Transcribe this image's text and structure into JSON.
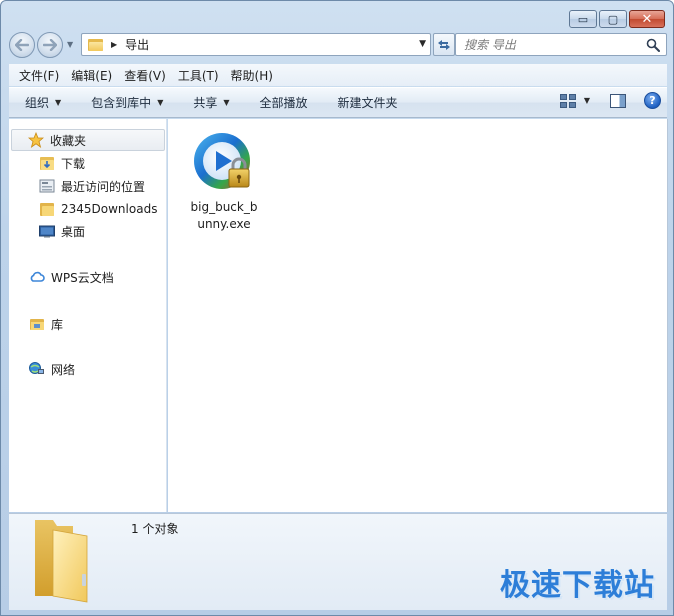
{
  "window": {
    "caption_buttons": {
      "minimize": "▭",
      "maximize": "▢",
      "close": "✕"
    }
  },
  "navigation": {
    "back_icon": "back-arrow-icon",
    "forward_icon": "forward-arrow-icon",
    "breadcrumb": {
      "current": "导出"
    },
    "search": {
      "placeholder": "搜索 导出"
    }
  },
  "menubar": {
    "items": [
      "文件(F)",
      "编辑(E)",
      "查看(V)",
      "工具(T)",
      "帮助(H)"
    ]
  },
  "command_bar": {
    "organize": "组织",
    "include_in_library": "包含到库中",
    "share": "共享",
    "play_all": "全部播放",
    "new_folder": "新建文件夹",
    "help": "?"
  },
  "sidebar": {
    "favorites": {
      "label": "收藏夹",
      "icon": "star-icon"
    },
    "favorite_items": [
      {
        "label": "下载",
        "icon": "downloads-folder-icon"
      },
      {
        "label": "最近访问的位置",
        "icon": "recent-places-icon"
      },
      {
        "label": "2345Downloads",
        "icon": "folder-icon"
      },
      {
        "label": "桌面",
        "icon": "desktop-icon"
      }
    ],
    "wps": {
      "label": "WPS云文档",
      "icon": "cloud-icon"
    },
    "libraries": {
      "label": "库",
      "icon": "library-icon"
    },
    "network": {
      "label": "网络",
      "icon": "network-icon"
    }
  },
  "content": {
    "files": [
      {
        "name": "big_buck_bunny.exe",
        "icon": "media-player-lock-icon"
      }
    ]
  },
  "details": {
    "count": "1 个对象",
    "watermark": "极速下载站"
  },
  "colors": {
    "accent": "#2d7ed8",
    "frame": "#bdd3ea"
  }
}
